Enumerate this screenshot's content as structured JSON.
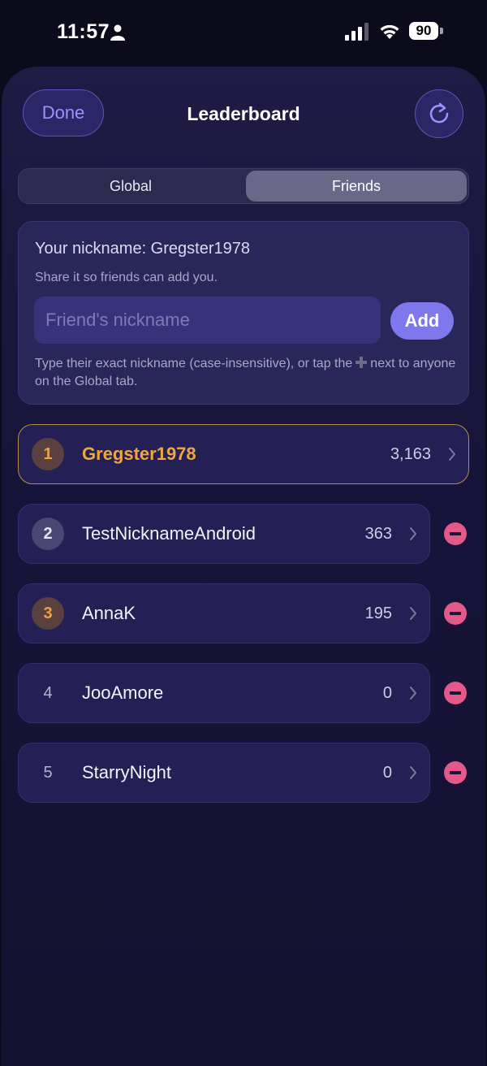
{
  "status_bar": {
    "time": "11:57",
    "battery": "90"
  },
  "header": {
    "done_label": "Done",
    "title": "Leaderboard"
  },
  "tabs": [
    {
      "label": "Global",
      "selected": false
    },
    {
      "label": "Friends",
      "selected": true
    }
  ],
  "nickname_card": {
    "nickname_line": "Your nickname: Gregster1978",
    "share_text": "Share it so friends can add you.",
    "input_placeholder": "Friend's nickname",
    "input_value": "",
    "add_label": "Add",
    "hint_before": "Type their exact nickname (case-insensitive), or tap the",
    "hint_after": "next to anyone on the Global tab."
  },
  "leaderboard": [
    {
      "rank": "1",
      "name": "Gregster1978",
      "score": "3,163",
      "is_me": true
    },
    {
      "rank": "2",
      "name": "TestNicknameAndroid",
      "score": "363",
      "is_me": false
    },
    {
      "rank": "3",
      "name": "AnnaK",
      "score": "195",
      "is_me": false
    },
    {
      "rank": "4",
      "name": "JooAmore",
      "score": "0",
      "is_me": false
    },
    {
      "rank": "5",
      "name": "StarryNight",
      "score": "0",
      "is_me": false
    }
  ],
  "icons": {
    "refresh": "refresh-icon",
    "chevron": "chevron-right-icon",
    "remove": "remove-friend-icon",
    "plus": "plus-icon"
  },
  "colors": {
    "accent": "#7f78ec",
    "gold": "#f0a640",
    "remove": "#e35a8a",
    "background": "#141130"
  }
}
